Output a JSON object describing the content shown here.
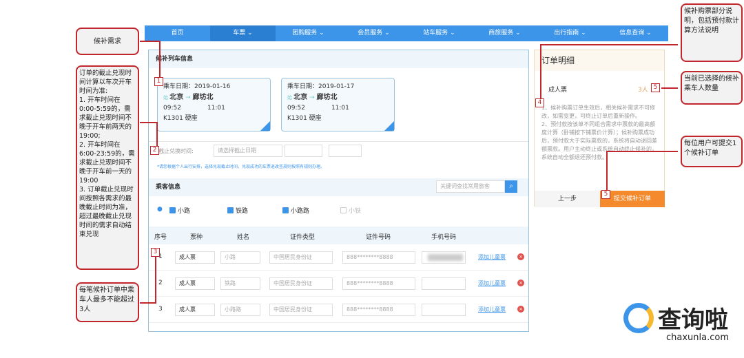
{
  "nav": [
    "首页",
    "车票 ⌄",
    "团购服务 ⌄",
    "会员服务 ⌄",
    "站车服务 ⌄",
    "商旅服务 ⌄",
    "出行指南 ⌄",
    "信息查询 ⌄"
  ],
  "train_section": {
    "title": "候补列车信息",
    "cards": [
      {
        "date": "乘车日期：2019-01-16",
        "from": "北京",
        "to": "廊坊北",
        "dep": "09:52",
        "arr": "11:01",
        "train": "K1301  硬座"
      },
      {
        "date": "乘车日期：2019-01-17",
        "from": "北京",
        "to": "廊坊北",
        "dep": "09:52",
        "arr": "11:01",
        "train": "K1301  硬座"
      }
    ]
  },
  "deadline": {
    "label": "截止兑换时间:",
    "placeholder": "请选择截止日期",
    "hint": "*请您根据个人出行安排，选择兑现截止时间，兑现成功的车票退改签规则按照有规则办理。"
  },
  "passenger_section": {
    "title": "乘客信息",
    "search_placeholder": "关键词查找常用旅客",
    "candidates": [
      {
        "name": "小路",
        "checked": true
      },
      {
        "name": "铁路",
        "checked": true
      },
      {
        "name": "小路路",
        "checked": true
      },
      {
        "name": "小铁",
        "checked": false
      }
    ],
    "headers": [
      "序号",
      "票种",
      "姓名",
      "证件类型",
      "证件号码",
      "手机号码"
    ],
    "rows": [
      {
        "no": "1",
        "type": "成人票",
        "name": "小路",
        "id_type": "中国居民身份证",
        "id": "888********8888",
        "link": "添加儿童票"
      },
      {
        "no": "2",
        "type": "成人票",
        "name": "铁路",
        "id_type": "中国居民身份证",
        "id": "888********8888",
        "link": "添加儿童票"
      },
      {
        "no": "3",
        "type": "成人票",
        "name": "小路路",
        "id_type": "中国居民身份证",
        "id": "888********8888",
        "link": "添加儿童票"
      }
    ]
  },
  "order": {
    "title": "订单明细",
    "ticket": "成人票",
    "count": "3人",
    "notes": "1、候补购票订单生效后，相关候补需求不可修改，如需变更，可终止订单后重新操作。\n2、预付款按该单不同组合需求中票款的最高额度计算（卧铺按下铺票价计算）；候补购票成功后，预付款大于实际票款的，系统将自动退回差额票款。用户主动终止或系统自动终止候补的，系统自动全额退还预付款。",
    "prev": "上一步",
    "submit": "提交候补订单"
  },
  "annotations": {
    "a_demand": "候补需求",
    "a_deadline": "订单的截止兑现时间计算以车次开车时间为准:\n1. 开车时间在0:00-5:59的，需求截止兑现时间不晚于开车前两天的19:00;\n2. 开车时间在6:00-23:59的，需求截止兑现时间不晚于开车前一天的19:00\n3. 订单截止兑现时间按照各需求的最晚截止时间为准，超过最晚截止兑现时间的需求自动结束兑现",
    "a_max": "每笔候补订单中乘车人最多不能超过3人",
    "a_notes": "候补购票部分说明，包括预付款计算方法说明",
    "a_count": "当前已选择的候补乘车人数量",
    "a_submit": "每位用户可提交1个候补订单",
    "tags": [
      "1",
      "2",
      "3",
      "4",
      "5",
      "5"
    ]
  },
  "watermark": {
    "text": "查询啦",
    "url": "chaxunla.com"
  },
  "colors": {
    "accent": "#3d95ea",
    "submit": "#f58a2c",
    "annotation": "#c0262c"
  }
}
